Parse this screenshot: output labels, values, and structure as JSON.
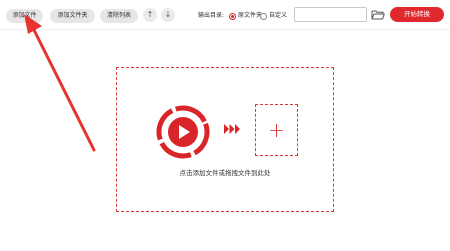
{
  "toolbar": {
    "add_file": "添加文件",
    "add_folder": "添加文件夹",
    "clear_list": "清除列表",
    "move_up": "↑",
    "move_down": "↓"
  },
  "output": {
    "label": "输出目录:",
    "options": [
      {
        "label": "原文件夹",
        "selected": true
      },
      {
        "label": "自定义",
        "selected": false
      }
    ],
    "path_value": ""
  },
  "start_button": "开始转换",
  "drop_zone": {
    "hint": "点击添加文件或拖拽文件到此处",
    "plus": "+"
  },
  "colors": {
    "accent": "#e0282d",
    "dashed_border": "#d83a3a",
    "annotation_arrow": "#e8342f"
  },
  "icons": [
    "folder-icon",
    "video-convert-logo-icon",
    "triple-chevron-icon",
    "plus-icon",
    "annotation-arrow"
  ]
}
